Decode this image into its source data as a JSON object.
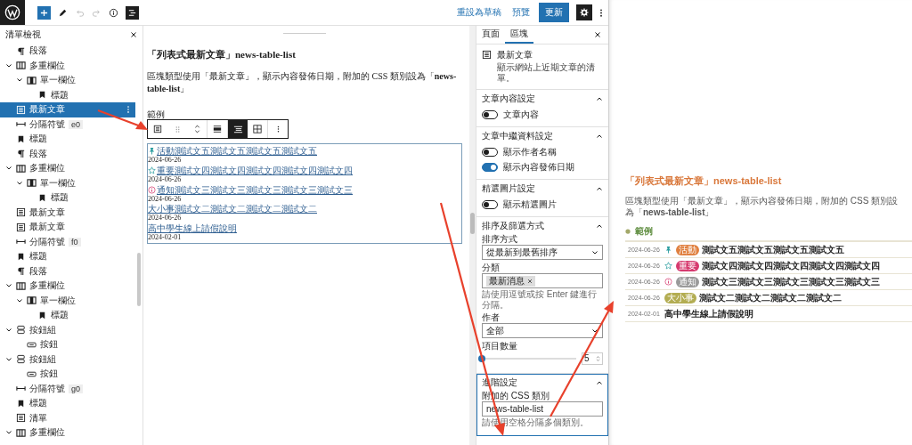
{
  "top_bar": {
    "secondary_actions": [
      "重設為草稿",
      "預覽"
    ],
    "primary_action": "更新"
  },
  "list_view": {
    "title": "清單檢視",
    "items": [
      {
        "kind": "paragraph",
        "label": "段落",
        "selected": false
      },
      {
        "kind": "columns",
        "label": "多重欄位",
        "selected": false,
        "expanded": true,
        "children": [
          {
            "kind": "column",
            "label": "單一欄位",
            "selected": false,
            "expanded": true,
            "children": [
              {
                "kind": "heading",
                "label": "標題",
                "selected": false
              }
            ]
          }
        ]
      },
      {
        "kind": "latest-posts",
        "label": "最新文章",
        "selected": true
      },
      {
        "kind": "separator",
        "label": "分隔符號",
        "badge": "e0",
        "selected": false
      },
      {
        "kind": "heading",
        "label": "標題",
        "selected": false
      },
      {
        "kind": "paragraph",
        "label": "段落",
        "selected": false
      },
      {
        "kind": "columns",
        "label": "多重欄位",
        "selected": false,
        "expanded": true,
        "children": [
          {
            "kind": "column",
            "label": "單一欄位",
            "selected": false,
            "expanded": true,
            "children": [
              {
                "kind": "heading",
                "label": "標題",
                "selected": false
              }
            ]
          }
        ]
      },
      {
        "kind": "latest-posts",
        "label": "最新文章",
        "selected": false
      },
      {
        "kind": "latest-posts",
        "label": "最新文章",
        "selected": false
      },
      {
        "kind": "separator",
        "label": "分隔符號",
        "badge": "f0",
        "selected": false
      },
      {
        "kind": "heading",
        "label": "標題",
        "selected": false
      },
      {
        "kind": "paragraph",
        "label": "段落",
        "selected": false
      },
      {
        "kind": "columns",
        "label": "多重欄位",
        "selected": false,
        "expanded": true,
        "children": [
          {
            "kind": "column",
            "label": "單一欄位",
            "selected": false,
            "expanded": true,
            "children": [
              {
                "kind": "heading",
                "label": "標題",
                "selected": false
              }
            ]
          }
        ]
      },
      {
        "kind": "buttons",
        "label": "按鈕組",
        "selected": false,
        "expanded": true,
        "children": [
          {
            "kind": "button",
            "label": "按鈕",
            "selected": false
          }
        ]
      },
      {
        "kind": "buttons",
        "label": "按鈕組",
        "selected": false,
        "expanded": true,
        "children": [
          {
            "kind": "button",
            "label": "按鈕",
            "selected": false
          }
        ]
      },
      {
        "kind": "separator",
        "label": "分隔符號",
        "badge": "g0",
        "selected": false
      },
      {
        "kind": "heading",
        "label": "標題",
        "selected": false
      },
      {
        "kind": "list",
        "label": "清單",
        "selected": false
      },
      {
        "kind": "columns",
        "label": "多重欄位",
        "selected": false,
        "expanded": true
      }
    ]
  },
  "canvas": {
    "heading": "「列表式最新文章」news-table-list",
    "paragraph": "區塊類型使用「最新文章」，顯示內容發佈日期，附加的 CSS 類別設為「**news-table-list**」",
    "example_label": "範例",
    "posts": [
      {
        "kind": "pin",
        "title": "活動測試文五測試文五測試文五測試文五",
        "date": "2024-06-26"
      },
      {
        "kind": "star",
        "title": "重要測試文四測試文四測試文四測試文四測試文四",
        "date": "2024-06-26"
      },
      {
        "kind": "info",
        "title": "通知測試文三測試文三測試文三測試文三測試文三",
        "date": "2024-06-26"
      },
      {
        "title": "大小事測試文二測試文二測試文二測試文二",
        "date": "2024-06-26"
      },
      {
        "title": "高中學生線上請假說明",
        "date": "2024-02-01"
      }
    ]
  },
  "settings": {
    "tabs": [
      {
        "label": "頁面",
        "selected": false
      },
      {
        "label": "區塊",
        "selected": true
      }
    ],
    "block": {
      "name": "最新文章",
      "description": "顯示網站上近期文章的清單。"
    },
    "sections": [
      {
        "kind": "toggles",
        "title": "文章內容設定",
        "expanded": true,
        "focused": false,
        "toggles": [
          {
            "label": "文章內容",
            "on": false
          }
        ]
      },
      {
        "kind": "toggles",
        "title": "文章中繼資料設定",
        "expanded": true,
        "focused": false,
        "toggles": [
          {
            "label": "顯示作者名稱",
            "on": false
          },
          {
            "label": "顯示內容發佈日期",
            "on": true
          }
        ]
      },
      {
        "kind": "toggles",
        "title": "精選圖片設定",
        "expanded": true,
        "focused": false,
        "toggles": [
          {
            "label": "顯示精選圖片",
            "on": false
          }
        ]
      },
      {
        "kind": "fields",
        "title": "排序及篩選方式",
        "expanded": true,
        "focused": false,
        "fields": [
          {
            "kind": "select",
            "label": "排序方式",
            "value": "從最新到最舊排序"
          },
          {
            "kind": "tokens",
            "label": "分類",
            "tokens": [
              "最新消息"
            ],
            "help": "請使用逗號或按 Enter 鍵進行分隔。"
          },
          {
            "kind": "select",
            "label": "作者",
            "value": "全部"
          },
          {
            "kind": "range",
            "label": "項目數量",
            "level": 0.0,
            "value": "5"
          }
        ]
      },
      {
        "kind": "fields",
        "title": "進階設定",
        "expanded": true,
        "focused": true,
        "fields": [
          {
            "kind": "text",
            "label": "附加的 CSS 類別",
            "value": "news-table-list",
            "help": "請使用空格分隔多個類別。"
          }
        ]
      }
    ]
  },
  "preview": {
    "heading": "「列表式最新文章」news-table-list",
    "paragraph": "區塊類型使用「最新文章」，顯示內容發佈日期，附加的 CSS 類別設為「**news-table-list**」",
    "example_label": "範例",
    "posts": [
      {
        "date": "2024-06-26",
        "kind": "pin",
        "tag": "活動",
        "color": "#e0803f",
        "title": "測試文五測試文五測試文五測試文五"
      },
      {
        "date": "2024-06-26",
        "kind": "star",
        "tag": "重要",
        "color": "#d63a6e",
        "title": "測試文四測試文四測試文四測試文四測試文四"
      },
      {
        "date": "2024-06-26",
        "kind": "info",
        "tag": "通知",
        "color": "#9a9a9a",
        "title": "測試文三測試文三測試文三測試文三測試文三"
      },
      {
        "date": "2024-06-26",
        "tag": "大小事",
        "color": "#b3ad52",
        "title": "測試文二測試文二測試文二測試文二"
      },
      {
        "date": "2024-02-01",
        "title": "高中學生線上請假說明"
      }
    ]
  }
}
